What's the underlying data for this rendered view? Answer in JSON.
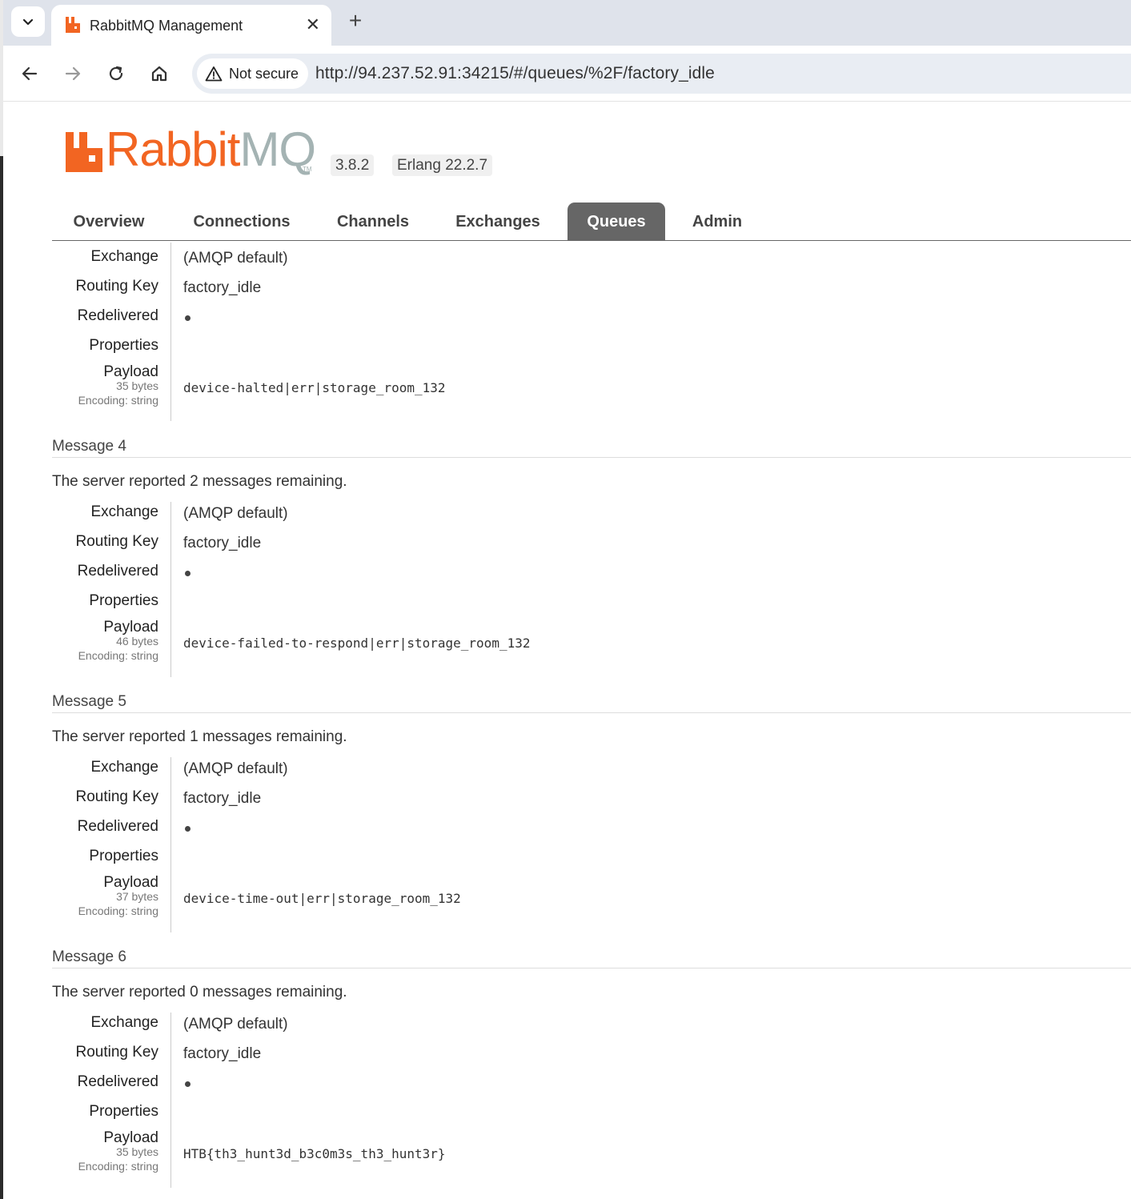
{
  "browser": {
    "tab_title": "RabbitMQ Management",
    "new_tab_symbol": "+",
    "close_symbol": "✕",
    "security_label": "Not secure",
    "url": "http://94.237.52.91:34215/#/queues/%2F/factory_idle"
  },
  "header": {
    "logo_rabbit": "Rabbit",
    "logo_mq": "MQ",
    "logo_tm": "TM",
    "version": "3.8.2",
    "erlang": "Erlang 22.2.7",
    "brand_color": "#f26522"
  },
  "nav": {
    "items": [
      "Overview",
      "Connections",
      "Channels",
      "Exchanges",
      "Queues",
      "Admin"
    ],
    "active": "Queues"
  },
  "labels": {
    "exchange": "Exchange",
    "routing_key": "Routing Key",
    "redelivered": "Redelivered",
    "properties": "Properties",
    "payload": "Payload",
    "encoding": "Encoding: string"
  },
  "messages": [
    {
      "exchange": "(AMQP default)",
      "routing_key": "factory_idle",
      "payload_bytes": "35 bytes",
      "payload": "device-halted|err|storage_room_132"
    },
    {
      "header": "Message 4",
      "remaining": "The server reported 2 messages remaining.",
      "exchange": "(AMQP default)",
      "routing_key": "factory_idle",
      "payload_bytes": "46 bytes",
      "payload": "device-failed-to-respond|err|storage_room_132"
    },
    {
      "header": "Message 5",
      "remaining": "The server reported 1 messages remaining.",
      "exchange": "(AMQP default)",
      "routing_key": "factory_idle",
      "payload_bytes": "37 bytes",
      "payload": "device-time-out|err|storage_room_132"
    },
    {
      "header": "Message 6",
      "remaining": "The server reported 0 messages remaining.",
      "exchange": "(AMQP default)",
      "routing_key": "factory_idle",
      "payload_bytes": "35 bytes",
      "payload": "HTB{th3_hunt3d_b3c0m3s_th3_hunt3r}"
    }
  ]
}
